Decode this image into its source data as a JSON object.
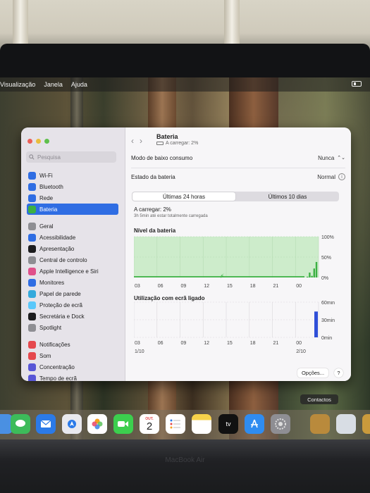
{
  "menubar": {
    "items": [
      "Visualização",
      "Janela",
      "Ajuda"
    ]
  },
  "sidebar": {
    "search_placeholder": "Pesquisa",
    "items": [
      {
        "label": "Wi-Fi",
        "icon": "wifi-icon",
        "color": "#2f6de3"
      },
      {
        "label": "Bluetooth",
        "icon": "bluetooth-icon",
        "color": "#2f6de3"
      },
      {
        "label": "Rede",
        "icon": "network-icon",
        "color": "#2f6de3"
      },
      {
        "label": "Bateria",
        "icon": "battery-icon",
        "color": "#3cb043",
        "active": true
      },
      {
        "label": "Geral",
        "icon": "gear-icon",
        "color": "#8e8e93"
      },
      {
        "label": "Acessibilidade",
        "icon": "accessibility-icon",
        "color": "#2f6de3"
      },
      {
        "label": "Apresentação",
        "icon": "appearance-icon",
        "color": "#1c1c1e"
      },
      {
        "label": "Central de controlo",
        "icon": "control-center-icon",
        "color": "#8e8e93"
      },
      {
        "label": "Apple Intelligence e Siri",
        "icon": "siri-icon",
        "color": "#e0508a"
      },
      {
        "label": "Monitores",
        "icon": "display-icon",
        "color": "#2f6de3"
      },
      {
        "label": "Papel de parede",
        "icon": "wallpaper-icon",
        "color": "#34aadc"
      },
      {
        "label": "Proteção de ecrã",
        "icon": "screensaver-icon",
        "color": "#5ac8fa"
      },
      {
        "label": "Secretária e Dock",
        "icon": "dock-icon",
        "color": "#1c1c1e"
      },
      {
        "label": "Spotlight",
        "icon": "spotlight-icon",
        "color": "#8e8e93"
      },
      {
        "label": "Notificações",
        "icon": "notifications-icon",
        "color": "#e5484d"
      },
      {
        "label": "Som",
        "icon": "sound-icon",
        "color": "#e5484d"
      },
      {
        "label": "Concentração",
        "icon": "focus-icon",
        "color": "#5856d6"
      },
      {
        "label": "Tempo de ecrã",
        "icon": "screen-time-icon",
        "color": "#5856d6"
      }
    ]
  },
  "header": {
    "title": "Bateria",
    "subtitle": "A carregar: 2%"
  },
  "settings": {
    "low_power_label": "Modo de baixo consumo",
    "low_power_value": "Nunca",
    "health_label": "Estado da bateria",
    "health_value": "Normal"
  },
  "tabs": {
    "left": "Últimas 24 horas",
    "right": "Últimos 10 dias",
    "selected": "left"
  },
  "charge": {
    "status": "A carregar: 2%",
    "estimate": "3h 5min até estar totalmente carregada"
  },
  "chart_data": [
    {
      "type": "area",
      "title": "Nível da bateria",
      "x": [
        "03",
        "06",
        "09",
        "12",
        "15",
        "18",
        "21",
        "00"
      ],
      "y_ticks": [
        "100%",
        "50%",
        "0%"
      ],
      "ylim": [
        0,
        100
      ],
      "grid": true,
      "recent_levels": [
        2,
        12,
        4,
        22,
        38
      ],
      "color": "#3cb043"
    },
    {
      "type": "bar",
      "title": "Utilização com ecrã ligado",
      "x": [
        "03",
        "06",
        "09",
        "12",
        "15",
        "18",
        "21",
        "00"
      ],
      "dates": [
        "1/10",
        "2/10"
      ],
      "y_ticks": [
        "60min",
        "30min",
        "0min"
      ],
      "ylim": [
        0,
        60
      ],
      "grid": true,
      "values": [
        0,
        0,
        0,
        0,
        0,
        0,
        0,
        0,
        44
      ],
      "color": "#2f4fd8"
    }
  ],
  "footer": {
    "options": "Opções...",
    "help": "?"
  },
  "dock": {
    "tooltip": "Contactos",
    "calendar_month": "OUT.",
    "calendar_day": "2",
    "tv_label": "tv"
  },
  "device": {
    "brand": "MacBook Air"
  }
}
